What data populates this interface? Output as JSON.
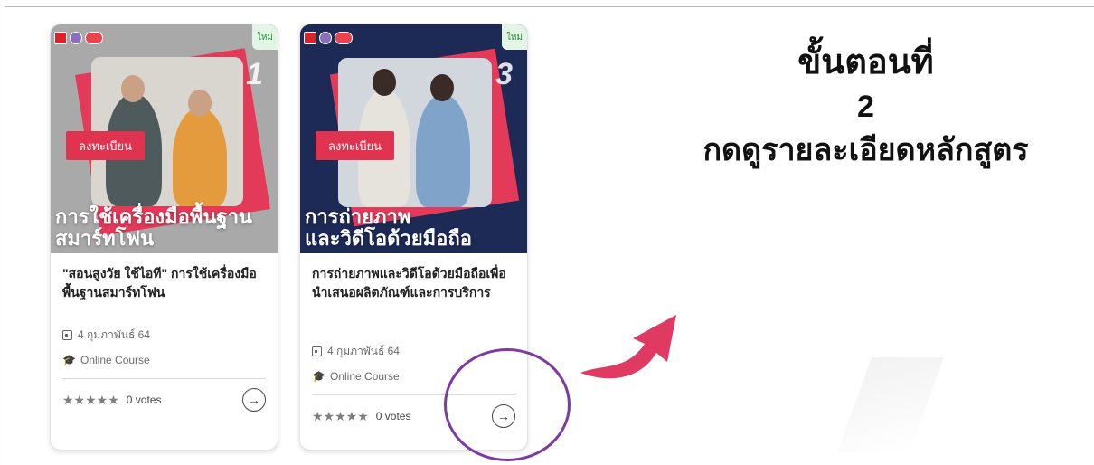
{
  "cards": [
    {
      "thumb_number": "1",
      "register_label": "ลงทะเบียน",
      "banner_line1": "การใช้เครื่องมือพื้นฐาน",
      "banner_line2": "สมาร์ทโฟน",
      "new_badge": "ใหม่",
      "title": "\"สอนสูงวัย ใช้ไอที\" การใช้เครื่องมือพื้นฐานสมาร์ทโฟน",
      "date": "4 กุมภาพันธ์ 64",
      "type": "Online Course",
      "stars": "★★★★★",
      "votes": "0 votes",
      "go_icon": "→"
    },
    {
      "thumb_number": "3",
      "register_label": "ลงทะเบียน",
      "banner_line1": "การถ่ายภาพ",
      "banner_line2": "และวิดีโอด้วยมือถือ",
      "new_badge": "ใหม่",
      "title": "การถ่ายภาพและวิดีโอด้วยมือถือเพื่อนำเสนอผลิตภัณฑ์และการบริการ",
      "date": "4 กุมภาพันธ์ 64",
      "type": "Online Course",
      "stars": "★★★★★",
      "votes": "0 votes",
      "go_icon": "→"
    }
  ],
  "instruction": {
    "line1": "ขั้นตอนที่",
    "line2": "2",
    "line3": "กดดูรายละเอียดหลักสูตร"
  },
  "colors": {
    "accent_red": "#e0334f",
    "highlight_purple": "#7d3aa3",
    "arrow_pink": "#e03a63"
  },
  "icons": {
    "calendar": "calendar-icon",
    "graduation_cap": "graduation-cap-icon",
    "arrow_right": "arrow-right-circle-icon"
  }
}
